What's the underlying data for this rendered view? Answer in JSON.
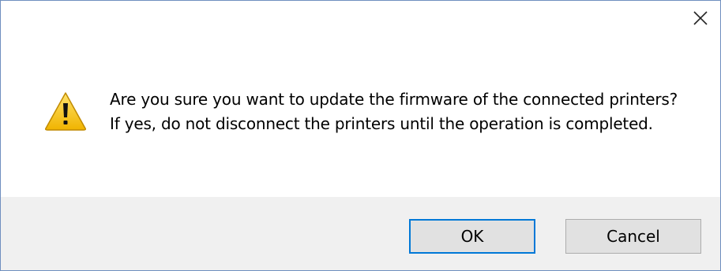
{
  "dialog": {
    "close_icon": "close-icon",
    "warning_icon": "warning-icon",
    "message": "Are you sure you want to update the firmware of the connected printers? If yes, do not disconnect the printers until the operation is completed.",
    "buttons": {
      "ok_label": "OK",
      "cancel_label": "Cancel"
    },
    "colors": {
      "border": "#6f8fbf",
      "footer_bg": "#f0f0f0",
      "button_bg": "#e1e1e1",
      "focus_border": "#0078d7",
      "warning_yellow": "#f5c400"
    }
  }
}
